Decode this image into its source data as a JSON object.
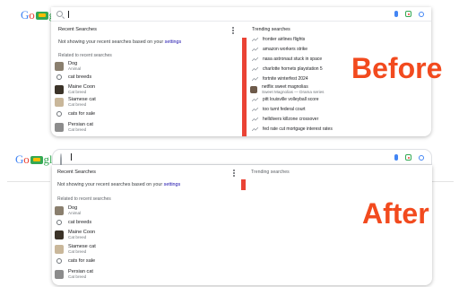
{
  "top": {
    "logo_parts": {
      "g": "G",
      "o1": "o",
      "rest": "gle"
    },
    "search": {
      "value": ""
    },
    "recent": {
      "header": "Recent Searches",
      "note_prefix": "Not showing your recent searches based on your",
      "note_link": "settings",
      "related_header": "Related to recent searches",
      "items": [
        {
          "title": "Dog",
          "subtitle": "Animal",
          "kind": "thumb",
          "color": "#8a7f6e"
        },
        {
          "title": "cat breeds",
          "subtitle": "",
          "kind": "query"
        },
        {
          "title": "Maine Coon",
          "subtitle": "Cat breed",
          "kind": "thumb",
          "color": "#3b3328"
        },
        {
          "title": "Siamese cat",
          "subtitle": "Cat breed",
          "kind": "thumb",
          "color": "#c9b79a"
        },
        {
          "title": "cats for sale",
          "subtitle": "",
          "kind": "query"
        },
        {
          "title": "Persian cat",
          "subtitle": "Cat breed",
          "kind": "thumb",
          "color": "#8c8c8c"
        }
      ]
    },
    "trending": {
      "header": "Trending searches",
      "items": [
        {
          "title": "frontier airlines flights",
          "subtitle": ""
        },
        {
          "title": "amazon workers strike",
          "subtitle": ""
        },
        {
          "title": "nasa astronaut stuck in space",
          "subtitle": ""
        },
        {
          "title": "charlotte hornets playstation 5",
          "subtitle": ""
        },
        {
          "title": "fortnite winterfest 2024",
          "subtitle": ""
        },
        {
          "title": "netflix sweet magnolias",
          "subtitle": "Sweet Magnolias — Drama series"
        },
        {
          "title": "pitt louisville volleyball score",
          "subtitle": ""
        },
        {
          "title": "too turnt federal court",
          "subtitle": ""
        },
        {
          "title": "helldivers killzone crossover",
          "subtitle": ""
        },
        {
          "title": "fed rate cut mortgage interest rates",
          "subtitle": ""
        }
      ]
    },
    "label": "Before"
  },
  "bottom": {
    "recent": {
      "header": "Recent Searches",
      "note_prefix": "Not showing your recent searches based on your",
      "note_link": "settings",
      "related_header": "Related to recent searches",
      "items": [
        {
          "title": "Dog",
          "subtitle": "Animal",
          "kind": "thumb",
          "color": "#8a7f6e"
        },
        {
          "title": "cat breeds",
          "subtitle": "",
          "kind": "query"
        },
        {
          "title": "Maine Coon",
          "subtitle": "Cat breed",
          "kind": "thumb",
          "color": "#3b3328"
        },
        {
          "title": "Siamese cat",
          "subtitle": "Cat breed",
          "kind": "thumb",
          "color": "#c9b79a"
        },
        {
          "title": "cats for sale",
          "subtitle": "",
          "kind": "query"
        },
        {
          "title": "Persian cat",
          "subtitle": "Cat breed",
          "kind": "thumb",
          "color": "#8c8c8c"
        }
      ]
    },
    "trending": {
      "header": "Trending searches"
    },
    "label": "After"
  },
  "colors": {
    "accent_red": "#ea4335",
    "label_orange": "#f24a1e",
    "link_blue": "#1a0dab"
  }
}
